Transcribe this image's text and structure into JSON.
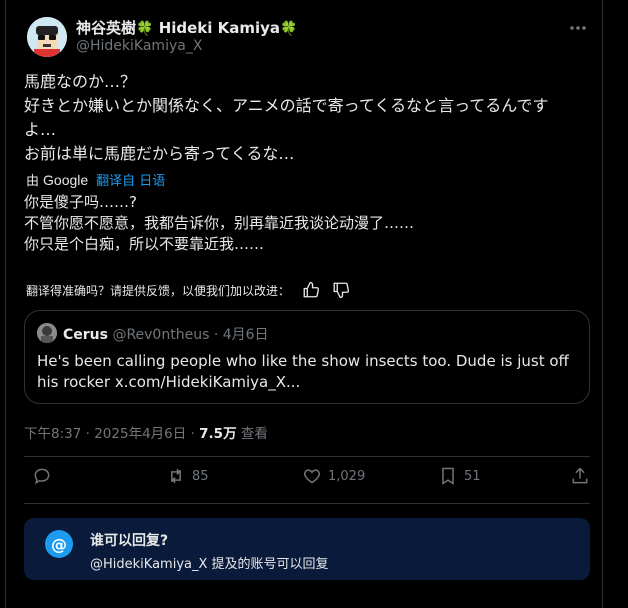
{
  "author": {
    "display_name": "神谷英樹",
    "name_latin": "Hideki Kamiya",
    "clover": "🍀",
    "handle": "@HidekiKamiya_X"
  },
  "tweet": {
    "lines": [
      "馬鹿なのか…？",
      "好きとか嫌いとか関係なく、アニメの話で寄ってくるなと言ってるんです",
      "よ…",
      "お前は単に馬鹿だから寄ってくるな…"
    ]
  },
  "translation": {
    "by": "由",
    "google": "Google",
    "translated_from": "翻译自 日语",
    "lines": [
      "你是傻子吗……?",
      "不管你愿不愿意，我都告诉你，别再靠近我谈论动漫了……",
      "你只是个白痴，所以不要靠近我……"
    ],
    "feedback_prompt": "翻译得准确吗？请提供反馈，以便我们加以改进："
  },
  "quote": {
    "name": "Cerus",
    "handle": "@Rev0ntheus",
    "dot": "·",
    "date": "4月6日",
    "text": "He's been calling people who like the show insects too. Dude is just off his rocker x.com/HidekiKamiya_X..."
  },
  "meta": {
    "time": "下午8:37",
    "dot": "·",
    "date": "2025年4月6日",
    "views_num": "7.5万",
    "views_label": "查看"
  },
  "actions": {
    "reply_count": "",
    "retweet_count": "85",
    "like_count": "1,029",
    "bookmark_count": "51"
  },
  "reply_restriction": {
    "icon_label": "@",
    "title": "谁可以回复?",
    "subtitle": "@HidekiKamiya_X 提及的账号可以回复"
  },
  "colors": {
    "background": "#000000",
    "accent": "#1d9bf0",
    "muted": "#71767b",
    "text": "#e7e9ea",
    "reply_box": "#0a1a3a"
  }
}
